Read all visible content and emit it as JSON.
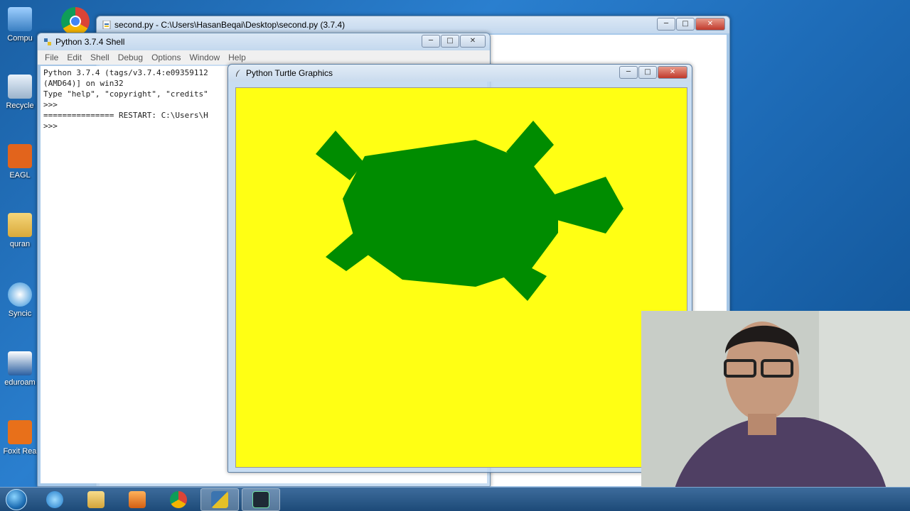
{
  "desktop": {
    "icons": [
      {
        "label": "Compu"
      },
      {
        "label": "Recycle"
      },
      {
        "label": "EAGL"
      },
      {
        "label": "quran"
      },
      {
        "label": "Syncic"
      },
      {
        "label": "eduroam"
      },
      {
        "label": "Foxit Rea"
      }
    ]
  },
  "editor_window": {
    "title": "second.py - C:\\Users\\HasanBeqai\\Desktop\\second.py (3.7.4)"
  },
  "shell_window": {
    "title": "Python 3.7.4 Shell",
    "menu": [
      "File",
      "Edit",
      "Shell",
      "Debug",
      "Options",
      "Window",
      "Help"
    ],
    "lines": [
      "Python 3.7.4 (tags/v3.7.4:e09359112",
      "(AMD64)] on win32",
      "Type \"help\", \"copyright\", \"credits\"",
      ">>>",
      "=============== RESTART: C:\\Users\\H",
      ">>>"
    ]
  },
  "turtle_window": {
    "title": "Python Turtle Graphics",
    "background_color": "#ffff14",
    "shape_color": "#008c00"
  },
  "taskbar": {
    "items": [
      "internet-explorer",
      "file-explorer",
      "media-player",
      "chrome",
      "python-idle",
      "other-app"
    ]
  }
}
